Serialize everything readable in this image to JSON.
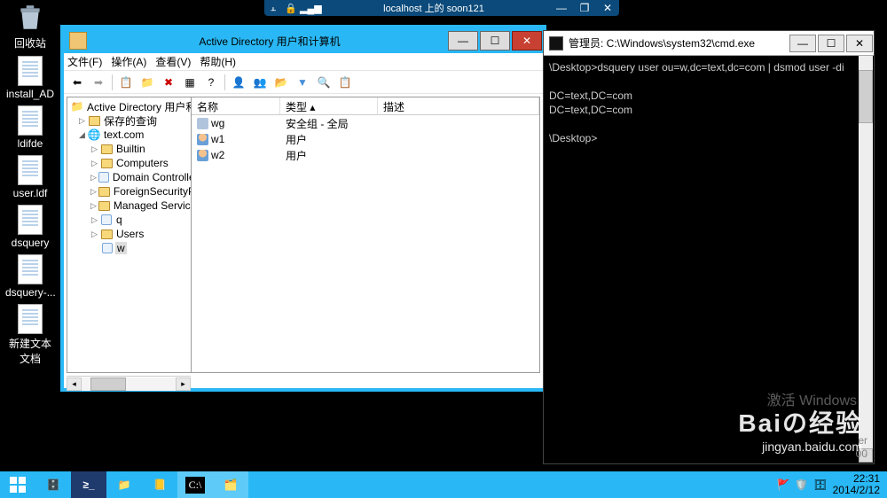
{
  "rdp": {
    "title": "localhost 上的 soon121"
  },
  "desktop": {
    "items": [
      {
        "label": "回收站",
        "type": "recycle"
      },
      {
        "label": "install_AD",
        "type": "txt"
      },
      {
        "label": "ldifde",
        "type": "txt"
      },
      {
        "label": "user.ldf",
        "type": "txt"
      },
      {
        "label": "dsquery",
        "type": "txt"
      },
      {
        "label": "dsquery-...",
        "type": "txt"
      },
      {
        "label": "新建文本文档",
        "type": "txt"
      }
    ]
  },
  "ad_window": {
    "title": "Active Directory 用户和计算机",
    "menus": [
      "文件(F)",
      "操作(A)",
      "查看(V)",
      "帮助(H)"
    ],
    "tree": {
      "root": "Active Directory 用户和计算机 [s",
      "saved": "保存的查询",
      "domain": "text.com",
      "children": [
        "Builtin",
        "Computers",
        "Domain Controllers",
        "ForeignSecurityPrincipals",
        "Managed Service Accoun",
        "q",
        "Users"
      ],
      "selected": "w"
    },
    "list": {
      "cols": [
        "名称",
        "类型",
        "描述"
      ],
      "rows": [
        {
          "name": "wg",
          "type": "安全组 - 全局",
          "desc": "",
          "icon": "group"
        },
        {
          "name": "w1",
          "type": "用户",
          "desc": "",
          "icon": "user"
        },
        {
          "name": "w2",
          "type": "用户",
          "desc": "",
          "icon": "user"
        }
      ]
    }
  },
  "cmd_window": {
    "title": "管理员: C:\\Windows\\system32\\cmd.exe",
    "lines": [
      "\\Desktop>dsquery user ou=w,dc=text,dc=com | dsmod user -di",
      "",
      "DC=text,DC=com",
      "DC=text,DC=com",
      "",
      "\\Desktop>"
    ],
    "rt_lines": [
      "er",
      "00"
    ]
  },
  "tray": {
    "time": "22:31",
    "date": "2014/2/12"
  },
  "activate": "激活 Windows",
  "watermark": {
    "l1": "Baiの经验",
    "l2": "jingyan.baidu.com"
  }
}
